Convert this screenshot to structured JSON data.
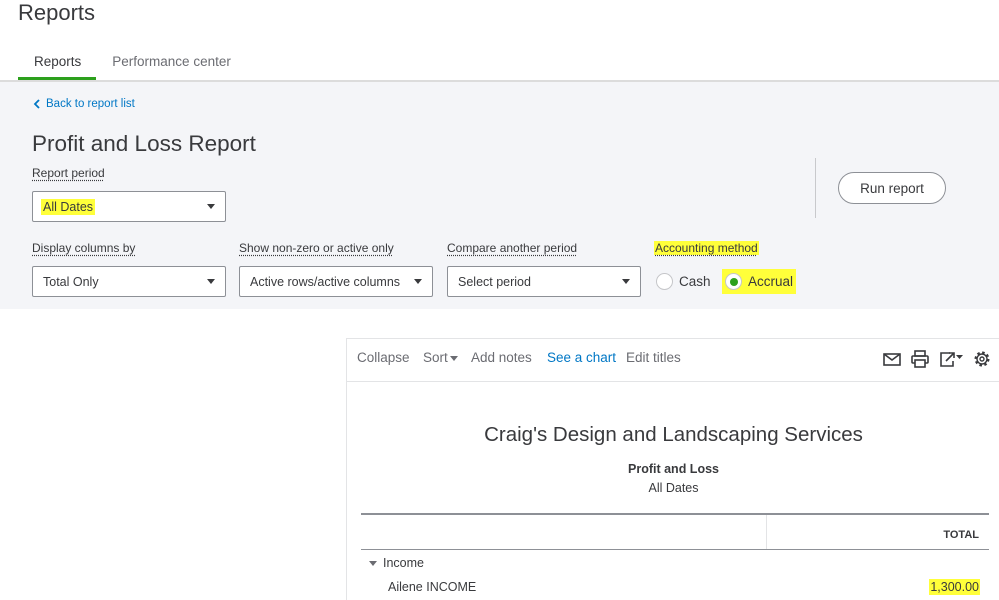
{
  "header": {
    "title": "Reports"
  },
  "tabs": [
    {
      "label": "Reports",
      "active": true
    },
    {
      "label": "Performance center",
      "active": false
    }
  ],
  "filters": {
    "back_link": "Back to report list",
    "report_title": "Profit and Loss Report",
    "report_period": {
      "label": "Report period",
      "value": "All Dates"
    },
    "display_columns": {
      "label": "Display columns by",
      "value": "Total Only"
    },
    "show_nonzero": {
      "label": "Show non-zero or active only",
      "value": "Active rows/active columns"
    },
    "compare_period": {
      "label": "Compare another period",
      "value": "Select period"
    },
    "accounting_method": {
      "label": "Accounting method",
      "options": [
        "Cash",
        "Accrual"
      ],
      "selected": "Accrual"
    },
    "run_button": "Run report"
  },
  "toolbar": {
    "collapse": "Collapse",
    "sort": "Sort",
    "add_notes": "Add notes",
    "see_chart": "See a chart",
    "edit_titles": "Edit titles",
    "icons": [
      "email-icon",
      "print-icon",
      "export-icon",
      "gear-icon"
    ]
  },
  "report": {
    "company": "Craig's Design and Landscaping Services",
    "title": "Profit and Loss",
    "period": "All Dates",
    "column_header": "TOTAL",
    "sections": [
      {
        "label": "Income",
        "rows": [
          {
            "account": "Ailene INCOME",
            "total": "1,300.00"
          }
        ]
      }
    ]
  },
  "colors": {
    "accent": "#2ca01c",
    "link": "#0077c5",
    "highlight": "#ffff3a"
  }
}
